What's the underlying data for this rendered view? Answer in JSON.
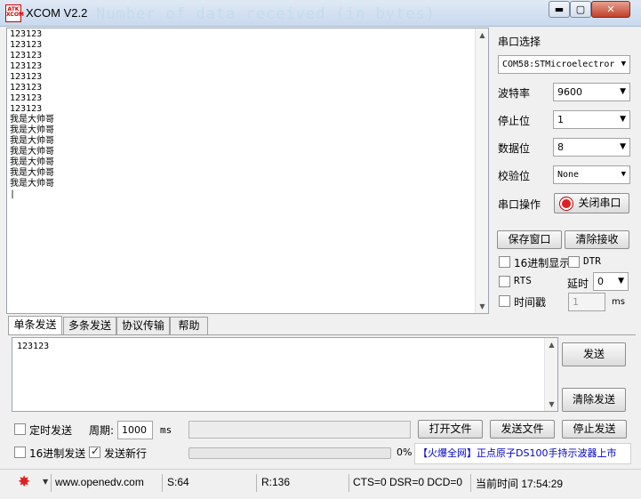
{
  "window": {
    "logo_text": "ATK XCOM",
    "title": "XCOM V2.2",
    "ghost_title": "Number of data received (in bytes)",
    "min_glyph": "▬",
    "max_glyph": "▢",
    "close_glyph": "✕"
  },
  "receive": {
    "text": "123123\n123123\n123123\n123123\n123123\n123123\n123123\n123123\n我是大帅哥\n我是大帅哥\n我是大帅哥\n我是大帅哥\n我是大帅哥\n我是大帅哥\n我是大帅哥\n|"
  },
  "settings": {
    "port_select_label": "串口选择",
    "port_value": "COM58:STMicroelectror",
    "baud_label": "波特率",
    "baud_value": "9600",
    "stop_label": "停止位",
    "stop_value": "1",
    "data_label": "数据位",
    "data_value": "8",
    "parity_label": "校验位",
    "parity_value": "None",
    "port_op_label": "串口操作",
    "close_port_button": "关闭串口",
    "save_window_button": "保存窗口",
    "clear_receive_button": "清除接收",
    "hex_display_label": "16进制显示",
    "hex_display_checked": false,
    "dtr_label": "DTR",
    "dtr_checked": false,
    "rts_label": "RTS",
    "rts_checked": false,
    "delay_label": "延时",
    "delay_value": "0",
    "timestamp_label": "时间戳",
    "timestamp_checked": false,
    "timestamp_ms_value": "1",
    "ms_unit": "ms"
  },
  "tabs": [
    {
      "label": "单条发送",
      "active": true
    },
    {
      "label": "多条发送",
      "active": false
    },
    {
      "label": "协议传输",
      "active": false
    },
    {
      "label": "帮助",
      "active": false
    }
  ],
  "send": {
    "text": "123123",
    "send_button": "发送",
    "clear_send_button": "清除发送",
    "timed_send_label": "定时发送",
    "timed_send_checked": false,
    "period_label": "周期:",
    "period_value": "1000",
    "period_unit": "ms",
    "open_file_button": "打开文件",
    "send_file_button": "发送文件",
    "stop_send_button": "停止发送",
    "hex_send_label": "16进制发送",
    "hex_send_checked": false,
    "newline_label": "发送新行",
    "newline_checked": true,
    "progress_percent": "0%",
    "progress_fraction": 0,
    "ad_link": "【火爆全网】正点原子DS100手持示波器上市"
  },
  "status": {
    "website": "www.openedv.com",
    "sent": "S:64",
    "received": "R:136",
    "signals": "CTS=0 DSR=0 DCD=0",
    "time": "当前时间 17:54:29"
  },
  "colors": {
    "accent_red": "#e02020",
    "link_blue": "#0000cc",
    "ghost_title": "#c4dcec"
  }
}
